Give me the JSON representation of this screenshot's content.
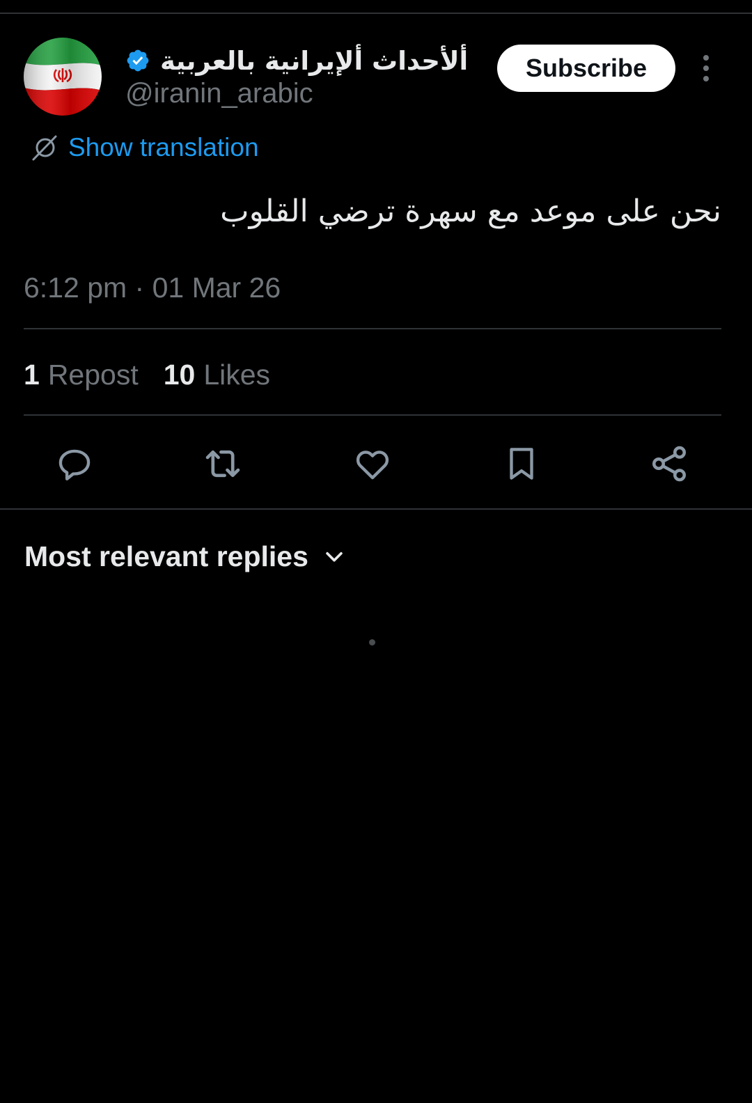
{
  "tweet": {
    "author": {
      "display_name": "ألأحداث ألإيرانية بالعربية",
      "handle": "@iranin_arabic",
      "verified": true,
      "avatar_icon": "iran-flag-avatar"
    },
    "subscribe_label": "Subscribe",
    "translate_label": "Show translation",
    "text": "نحن على موعد مع سهرة ترضي القلوب",
    "timestamp": "6:12 pm · 01 Mar 26",
    "stats": {
      "reposts_count": "1",
      "reposts_label": "Repost",
      "likes_count": "10",
      "likes_label": "Likes"
    },
    "actions": [
      "reply-icon",
      "repost-icon",
      "like-icon",
      "bookmark-icon",
      "share-icon"
    ]
  },
  "replies": {
    "sort_label": "Most relevant replies"
  },
  "colors": {
    "background": "#000000",
    "text_primary": "#e7e9ea",
    "text_secondary": "#71767b",
    "accent": "#1d9bf0",
    "divider": "#2f3336"
  }
}
